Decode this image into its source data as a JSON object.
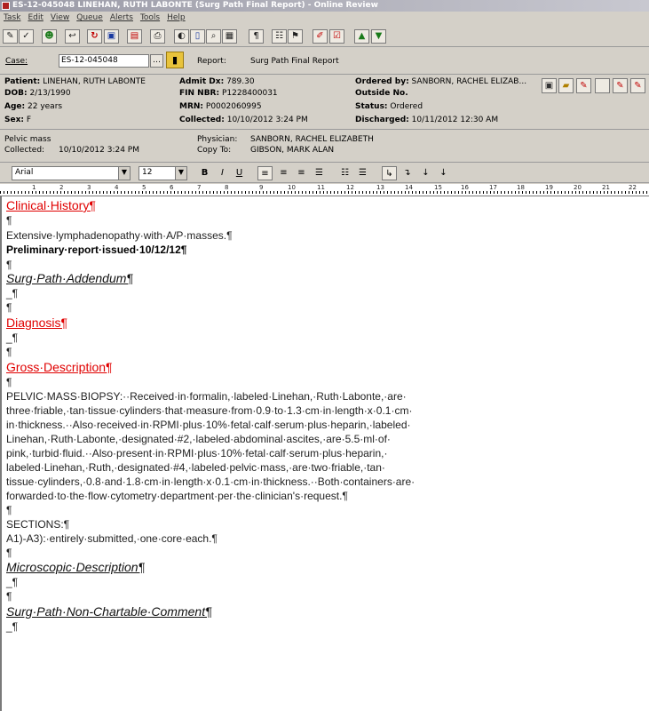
{
  "window": {
    "title": "ES-12-045048 LINEHAN, RUTH LABONTE (Surg Path Final Report) - Online Review"
  },
  "menu": [
    "Task",
    "Edit",
    "View",
    "Queue",
    "Alerts",
    "Tools",
    "Help"
  ],
  "toolbar_icons": [
    "pencil-icon",
    "check-pencil-icon",
    "sign-icon",
    "undo-icon",
    "refresh-icon",
    "image-icon",
    "folder-icon",
    "print-icon",
    "info-icon",
    "copy-icon",
    "find-icon",
    "save-icon",
    "paragraph-icon",
    "notes-icon",
    "flag-icon",
    "edit-icon",
    "checkbox-icon",
    "arrow-up-icon",
    "arrow-down-icon"
  ],
  "case": {
    "label": "Case:",
    "value": "ES-12-045048",
    "report_label": "Report:",
    "report_value": "Surg Path Final Report"
  },
  "patient": {
    "patient_label": "Patient:",
    "patient": "LINEHAN, RUTH LABONTE",
    "dob_label": "DOB:",
    "dob": "2/13/1990",
    "age_label": "Age:",
    "age": "22 years",
    "sex_label": "Sex:",
    "sex": "F",
    "admit_label": "Admit Dx:",
    "admit": "789.30",
    "fin_label": "FIN NBR:",
    "fin": "P1228400031",
    "mrn_label": "MRN:",
    "mrn": "P0002060995",
    "collected_label": "Collected:",
    "collected": "10/10/2012 3:24 PM",
    "ordered_label": "Ordered by:",
    "ordered": "SANBORN, RACHEL ELIZAB...",
    "outside_label": "Outside No.",
    "outside": "",
    "status_label": "Status:",
    "status": "Ordered",
    "discharged_label": "Discharged:",
    "discharged": "10/11/2012 12:30 AM"
  },
  "specimen": {
    "name": "Pelvic mass",
    "collected_label": "Collected:",
    "collected": "10/10/2012 3:24 PM",
    "physician_label": "Physician:",
    "physician": "SANBORN, RACHEL ELIZABETH",
    "copyto_label": "Copy To:",
    "copyto": "GIBSON, MARK ALAN"
  },
  "format": {
    "font": "Arial",
    "size": "12",
    "bold": "B",
    "italic": "I",
    "underline": "U"
  },
  "ruler": [
    "1",
    "2",
    "3",
    "4",
    "5",
    "6",
    "7",
    "8",
    "9",
    "10",
    "11",
    "12",
    "13",
    "14",
    "15",
    "16",
    "17",
    "18",
    "19",
    "20",
    "21",
    "22"
  ],
  "doc": {
    "clinical_history": "Clinical·History¶",
    "p1": "¶",
    "history_text": "Extensive·lymphadenopathy·with·A/P·masses.¶",
    "prelim": "Preliminary·report·issued·10/12/12¶",
    "p2": "¶",
    "addendum": "Surg·Path·Addendum¶",
    "p3": "_¶",
    "p4": "¶",
    "diagnosis": "Diagnosis¶",
    "p5": "_¶",
    "p6": "¶",
    "gross": "Gross·Description¶",
    "p7": "¶",
    "gross_lines": [
      "PELVIC·MASS·BIOPSY:··Received·in·formalin,·labeled·Linehan,·Ruth·Labonte,·are·",
      "three·friable,·tan·tissue·cylinders·that·measure·from·0.9·to·1.3·cm·in·length·x·0.1·cm·",
      "in·thickness.··Also·received·in·RPMI·plus·10%·fetal·calf·serum·plus·heparin,·labeled·",
      "Linehan,·Ruth·Labonte,·designated·#2,·labeled·abdominal·ascites,·are·5.5·ml·of·",
      "pink,·turbid·fluid.··Also·present·in·RPMI·plus·10%·fetal·calf·serum·plus·heparin,·",
      "labeled·Linehan,·Ruth,·designated·#4,·labeled·pelvic·mass,·are·two·friable,·tan·",
      "tissue·cylinders,·0.8·and·1.8·cm·in·length·x·0.1·cm·in·thickness.··Both·containers·are·",
      "forwarded·to·the·flow·cytometry·department·per·the·clinician's·request.¶"
    ],
    "p8": "¶",
    "sections": "SECTIONS:¶",
    "sections_text": "A1)-A3):·entirely·submitted,·one·core·each.¶",
    "p9": "¶",
    "micro": "Microscopic·Description¶",
    "p10": "_¶",
    "p11": "¶",
    "nonchart": "Surg·Path·Non-Chartable·Comment¶",
    "p12": "_¶"
  }
}
